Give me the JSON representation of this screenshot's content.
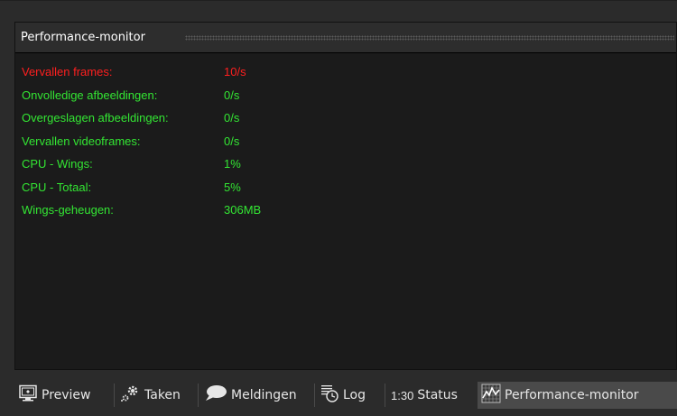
{
  "panel": {
    "title": "Performance-monitor"
  },
  "stats": [
    {
      "label": "Vervallen frames:",
      "value": "10/s",
      "color": "#ff1f1f"
    },
    {
      "label": "Onvolledige afbeeldingen:",
      "value": "0/s",
      "color": "#33e633"
    },
    {
      "label": "Overgeslagen afbeeldingen:",
      "value": "0/s",
      "color": "#33e633"
    },
    {
      "label": "Vervallen videoframes:",
      "value": "0/s",
      "color": "#33e633"
    },
    {
      "label": "CPU - Wings:",
      "value": "1%",
      "color": "#33e633"
    },
    {
      "label": "CPU - Totaal:",
      "value": "5%",
      "color": "#33e633"
    },
    {
      "label": "Wings-geheugen:",
      "value": "306MB",
      "color": "#33e633"
    }
  ],
  "tabs": {
    "preview": {
      "label": "Preview",
      "icon": "monitor-icon"
    },
    "taken": {
      "label": "Taken",
      "icon": "gears-icon"
    },
    "meldingen": {
      "label": "Meldingen",
      "icon": "speech-bubble-icon"
    },
    "log": {
      "label": "Log",
      "icon": "log-clock-icon"
    },
    "status": {
      "label": "Status",
      "time": "1:30",
      "icon": "status-time-icon"
    },
    "performance": {
      "label": "Performance-monitor",
      "icon": "performance-graph-icon",
      "active": true
    }
  }
}
